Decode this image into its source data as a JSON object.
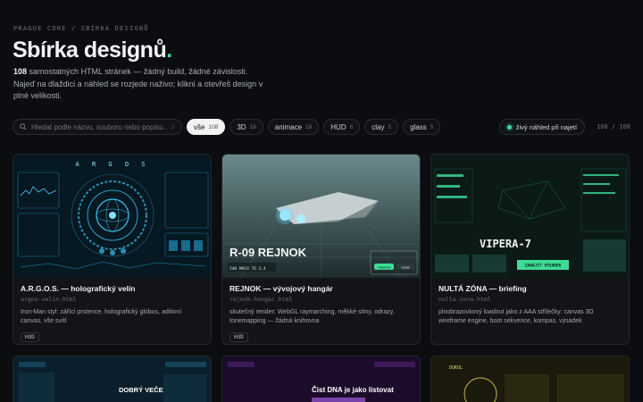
{
  "header": {
    "breadcrumb": "PRAGUE CORE / SBÍRKA DESIGNŮ",
    "title": "Sbírka designů",
    "title_dot": ".",
    "intro_count": "108",
    "intro_rest": " samostatných HTML stránek — žádný build, žádné závislosti. Najeď na dlaždici a náhled se rozjede naživo; klikni a otevřeš design v plné velikosti."
  },
  "toolbar": {
    "search_placeholder": "Hledat podle názvu, souboru nebo popisu…",
    "search_shortcut": "/",
    "filters": [
      {
        "label": "vše",
        "count": "108"
      },
      {
        "label": "3D",
        "count": "18"
      },
      {
        "label": "animace",
        "count": "18"
      },
      {
        "label": "HUD",
        "count": "6"
      },
      {
        "label": "clay",
        "count": "5"
      },
      {
        "label": "glass",
        "count": "5"
      }
    ],
    "live_label": "živý náhled při najetí",
    "result_count": "108 / 108"
  },
  "cards": [
    {
      "title": "A.R.G.O.S. — holografický velín",
      "file": "argos-velin.html",
      "desc": "Iron-Man styl: zářící prstence, holografický glóbus, aditivní canvas, vše svítí",
      "tag": "HUD",
      "thumb": {
        "heading": "A R G O S"
      }
    },
    {
      "title": "REJNOK — vývojový hangár",
      "file": "rejnok-hangar.html",
      "desc": "skutečný render: WebGL raymarching, měkké stíny, odrazy, tonemapping — žádná knihovna",
      "tag": "HUD",
      "thumb": {
        "heading": "R-09 REJNOK",
        "stats": "540  MACH  76  2,4",
        "btn1": "Objednat",
        "btn2": "Detail"
      }
    },
    {
      "title": "NULTÁ ZÓNA — briefing",
      "file": "nulta-zona.html",
      "desc": "plnobrazovkový loadout jako z AAA střílečky: canvas 3D wireframe engine, boot sekvence, kompas, výsadek",
      "tag": "",
      "thumb": {
        "heading": "VIPERA-7",
        "cta": "ZAHÁJIT VÝSADEK"
      }
    },
    {
      "title": "",
      "file": "",
      "desc": "",
      "tag": "",
      "thumb": {
        "heading": "DOBRÝ VEČER, ADAME"
      }
    },
    {
      "title": "",
      "file": "",
      "desc": "",
      "tag": "",
      "thumb": {
        "heading": "Čist DNA je jako listovat"
      }
    },
    {
      "title": "",
      "file": "",
      "desc": "",
      "tag": "",
      "thumb": {
        "heading": "DUKOL"
      }
    }
  ],
  "colors": {
    "accent": "#3ddc97",
    "background": "#0c0d10"
  }
}
